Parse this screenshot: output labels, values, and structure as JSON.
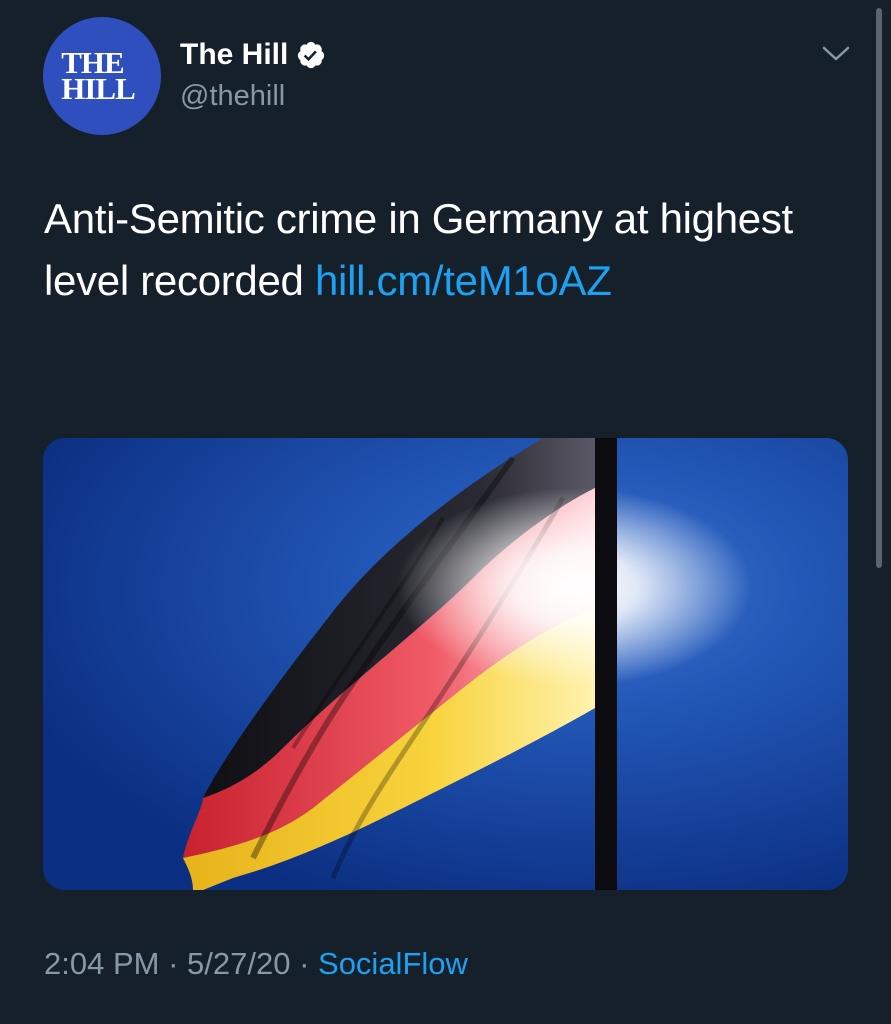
{
  "author": {
    "avatar_text_line1": "THE",
    "avatar_text_line2": "HILL",
    "display_name": "The Hill",
    "handle": "@thehill",
    "verified": true
  },
  "tweet": {
    "text": "Anti-Semitic crime in Germany at highest level recorded ",
    "link_text": "hill.cm/teM1oAZ",
    "media": {
      "alt_subject": "german-flag-photo"
    }
  },
  "meta": {
    "time": "2:04 PM",
    "separator1": " · ",
    "date": "5/27/20",
    "separator2": " · ",
    "source": "SocialFlow"
  },
  "colors": {
    "background": "#15202b",
    "link": "#1da1f2",
    "secondary_text": "#8899a6",
    "avatar": "#2f4fbf"
  },
  "icons": {
    "verified": "verified-badge-icon",
    "menu": "chevron-down-icon"
  }
}
